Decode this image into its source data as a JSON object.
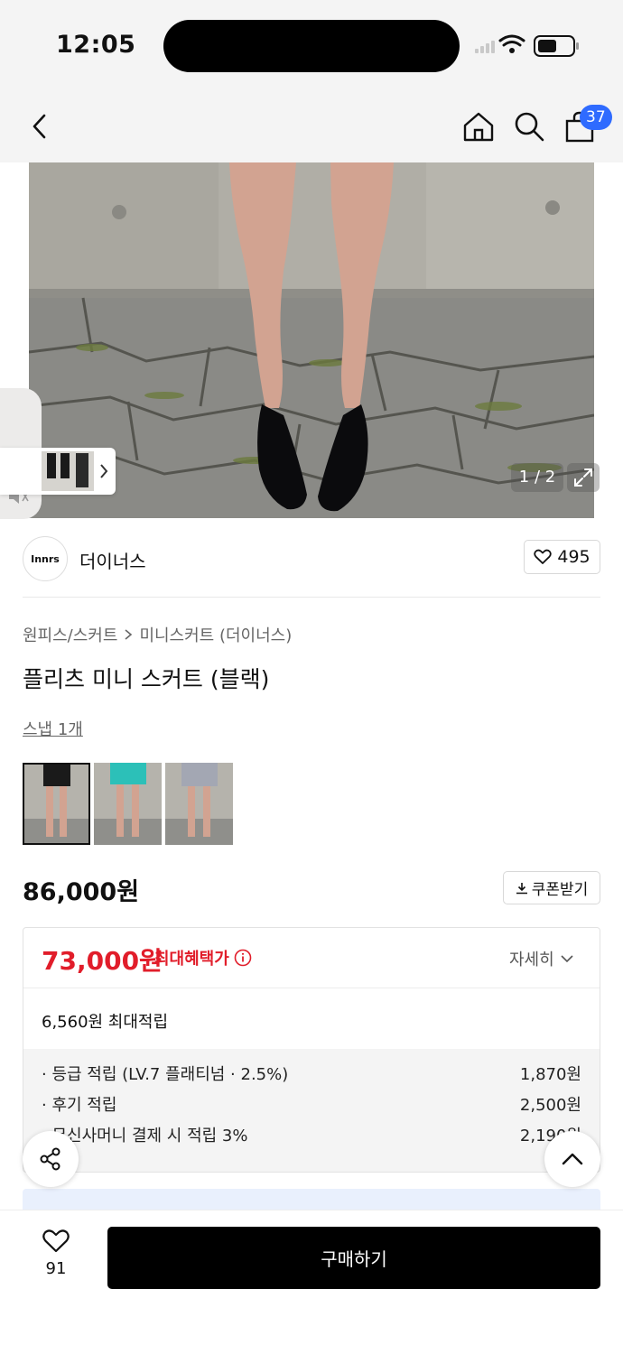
{
  "status_bar": {
    "time": "12:05"
  },
  "nav": {
    "cart_count": "37"
  },
  "gallery": {
    "pager": "1 / 2"
  },
  "brand": {
    "logo_text": "Innrs",
    "name": "더이너스",
    "like_count": "495"
  },
  "breadcrumb": {
    "category": "원피스/스커트",
    "subcategory": "미니스커트 (더이너스)"
  },
  "product": {
    "title": "플리츠 미니 스커트 (블랙)",
    "snap_link": "스냅 1개",
    "color_options": [
      {
        "name": "black",
        "color": "#1a1a1a"
      },
      {
        "name": "turquoise",
        "color": "#2cc0b8"
      },
      {
        "name": "grey",
        "color": "#a3a7b3"
      }
    ],
    "price": "86,000원",
    "coupon_label": "쿠폰받기"
  },
  "benefit": {
    "max_price": "73,000원",
    "max_label": "최대혜택가",
    "detail_label": "자세히",
    "reward_total": "6,560원 최대적립",
    "rewards": [
      {
        "label": "· 등급 적립 (LV.7 플래티넘 · 2.5%)",
        "amount": "1,870원"
      },
      {
        "label": "· 후기 적립",
        "amount": "2,500원"
      },
      {
        "label": "· 무신사머니 결제 시 적립 3%",
        "amount": "2,190원"
      }
    ]
  },
  "bottom": {
    "wish_count": "91",
    "buy_label": "구매하기"
  }
}
